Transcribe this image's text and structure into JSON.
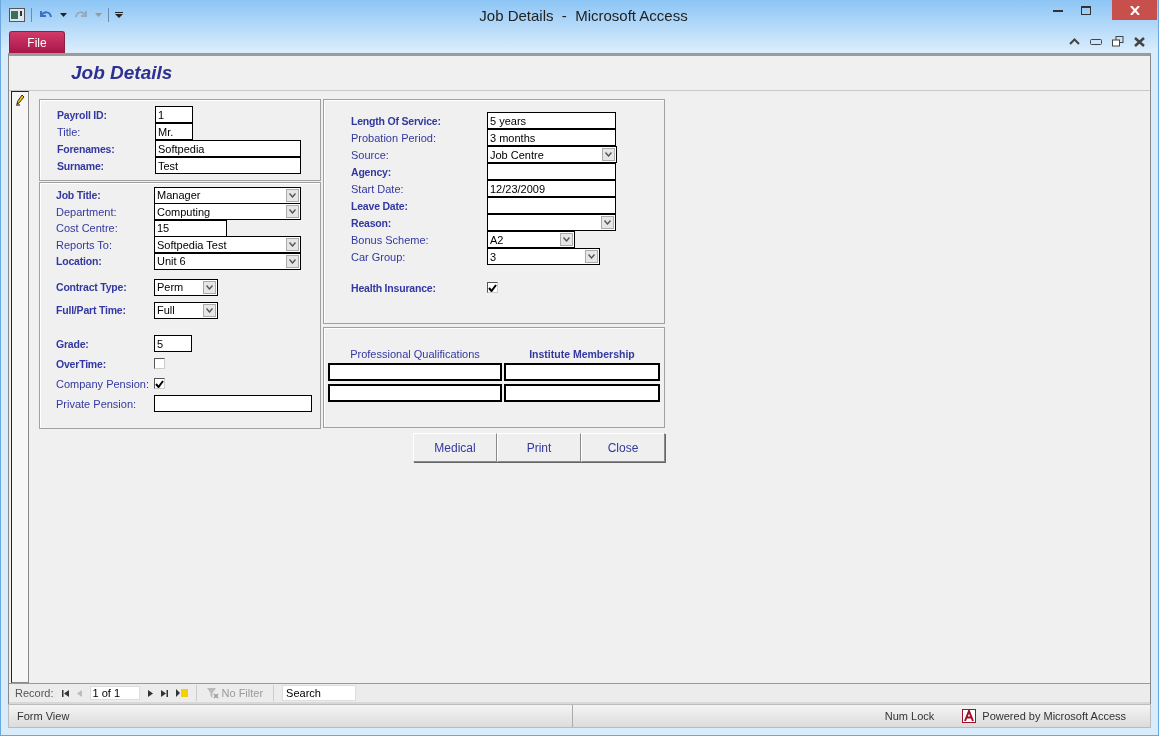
{
  "window": {
    "title": "Job Details  -  Microsoft Access"
  },
  "ribbon": {
    "file_tab": "File"
  },
  "form": {
    "title": "Job Details",
    "panels": [
      {
        "groups": [
          {
            "fields": [
              {
                "label": "Payroll ID:",
                "bold": true,
                "kind": "text",
                "value": "1"
              },
              {
                "label": "Title:",
                "bold": false,
                "kind": "text",
                "value": "Mr."
              },
              {
                "label": "Forenames:",
                "bold": true,
                "kind": "text",
                "value": "Softpedia"
              },
              {
                "label": "Surname:",
                "bold": true,
                "kind": "text",
                "value": "Test"
              }
            ]
          }
        ]
      },
      {
        "groups": [
          {
            "fields": [
              {
                "label": "Job Title:",
                "bold": true,
                "kind": "combo",
                "value": "Manager"
              },
              {
                "label": "Department:",
                "bold": false,
                "kind": "combo",
                "value": "Computing"
              },
              {
                "label": "Cost Centre:",
                "bold": false,
                "kind": "text",
                "value": "15"
              },
              {
                "label": "Reports To:",
                "bold": false,
                "kind": "combo",
                "value": "Softpedia Test"
              },
              {
                "label": "Location:",
                "bold": true,
                "kind": "combo",
                "value": "Unit 6"
              }
            ]
          },
          {
            "fields": [
              {
                "label": "Contract Type:",
                "bold": true,
                "kind": "combo",
                "value": "Perm"
              },
              {
                "label": "Full/Part Time:",
                "bold": true,
                "kind": "combo",
                "value": "Full"
              }
            ]
          },
          {
            "fields": [
              {
                "label": "Grade:",
                "bold": true,
                "kind": "text",
                "value": "5"
              },
              {
                "label": "OverTime:",
                "bold": true,
                "kind": "check",
                "checked": false
              },
              {
                "label": "Company Pension:",
                "bold": false,
                "kind": "check",
                "checked": true
              },
              {
                "label": "Private Pension:",
                "bold": false,
                "kind": "text"
              }
            ]
          }
        ]
      },
      {
        "groups": [
          {
            "fields": [
              {
                "label": "Length Of Service:",
                "bold": true,
                "kind": "text",
                "value": "5 years"
              },
              {
                "label": "Probation Period:",
                "bold": false,
                "kind": "text",
                "value": "3 months"
              },
              {
                "label": "Source:",
                "bold": false,
                "kind": "combo",
                "value": "Job Centre"
              },
              {
                "label": "Agency:",
                "bold": true,
                "kind": "text"
              },
              {
                "label": "Start Date:",
                "bold": false,
                "kind": "text",
                "value": "12/23/2009"
              },
              {
                "label": "Leave Date:",
                "bold": true,
                "kind": "text"
              },
              {
                "label": "Reason:",
                "bold": true,
                "kind": "combo"
              },
              {
                "label": "Bonus Scheme:",
                "bold": false,
                "kind": "combo",
                "value": "A2"
              },
              {
                "label": "Car Group:",
                "bold": false,
                "kind": "combo",
                "value": "3"
              }
            ]
          },
          {
            "fields": [
              {
                "label": "Health Insurance:",
                "bold": true,
                "kind": "check",
                "checked": true
              }
            ]
          }
        ]
      }
    ],
    "subtable": {
      "columns": [
        {
          "heading": "Professional Qualifications",
          "bold": false
        },
        {
          "heading": "Institute Membership",
          "bold": true
        }
      ]
    },
    "buttons": [
      "Medical",
      "Print",
      "Close"
    ]
  },
  "navigation": {
    "label": "Record:",
    "position": "1 of 1",
    "filter": "No Filter",
    "search": {
      "placeholder": "Search"
    }
  },
  "status_bar": {
    "view": "Form View",
    "num_lock": "Num Lock",
    "powered_by": "Powered by Microsoft Access"
  }
}
